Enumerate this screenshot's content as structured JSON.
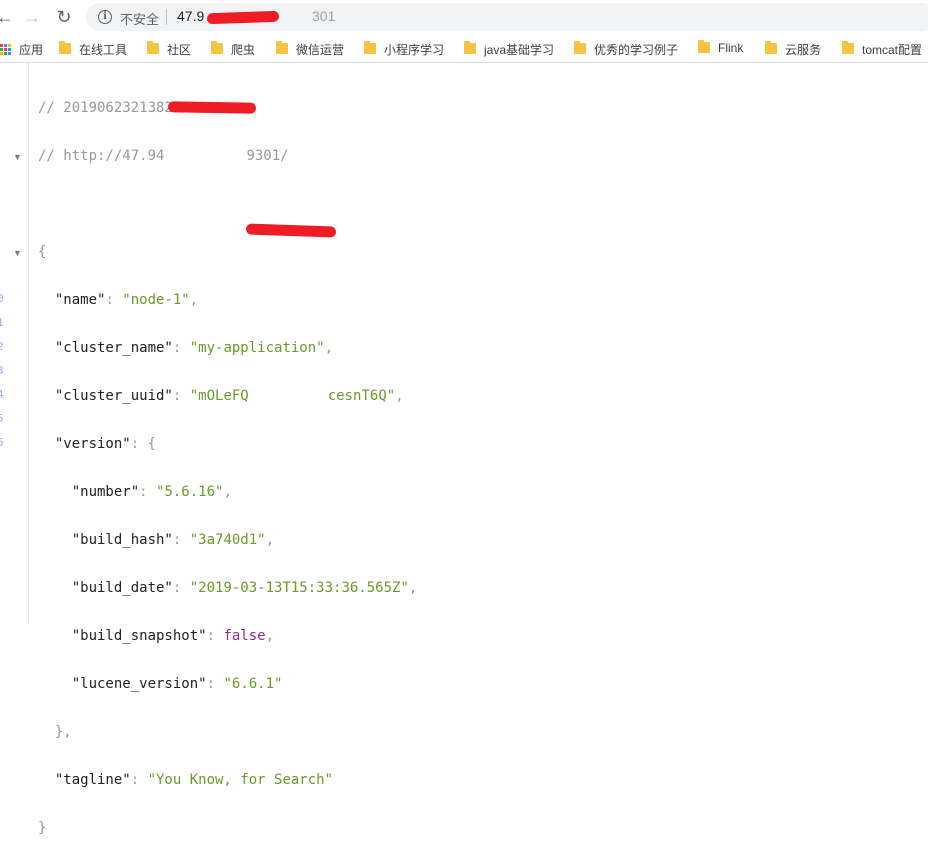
{
  "browser": {
    "insecure_label": "不安全",
    "url_visible_start": "47.9",
    "url_visible_end": "301",
    "bookmarks": [
      "应用",
      "在线工具",
      "社区",
      "爬虫",
      "微信运营",
      "小程序学习",
      "java基础学习",
      "优秀的学习例子",
      "Flink",
      "云服务",
      "tomcat配置"
    ]
  },
  "json_view": {
    "comment_time": "// 20190623213823",
    "comment_url_start": "// http://47.94",
    "comment_url_end": "9301/",
    "name_key": "\"name\"",
    "name_val": "\"node-1\"",
    "cluster_name_key": "\"cluster_name\"",
    "cluster_name_val": "\"my-application\"",
    "cluster_uuid_key": "\"cluster_uuid\"",
    "cluster_uuid_val_start": "\"mOLeFQ",
    "cluster_uuid_val_end": "cesnT6Q\"",
    "version_key": "\"version\"",
    "number_key": "\"number\"",
    "number_val": "\"5.6.16\"",
    "build_hash_key": "\"build_hash\"",
    "build_hash_val": "\"3a740d1\"",
    "build_date_key": "\"build_date\"",
    "build_date_val": "\"2019-03-13T15:33:36.565Z\"",
    "build_snapshot_key": "\"build_snapshot\"",
    "build_snapshot_val": "false",
    "lucene_version_key": "\"lucene_version\"",
    "lucene_version_val": "\"6.6.1\"",
    "tagline_key": "\"tagline\"",
    "tagline_val": "\"You Know, for Search\""
  },
  "gutter_numbers": [
    "0",
    "1",
    "2",
    "3",
    "4",
    "5",
    "6"
  ],
  "colors": {
    "string": "#6a9a2a",
    "boolean": "#8a2c8a",
    "redaction": "#ee1c25"
  }
}
